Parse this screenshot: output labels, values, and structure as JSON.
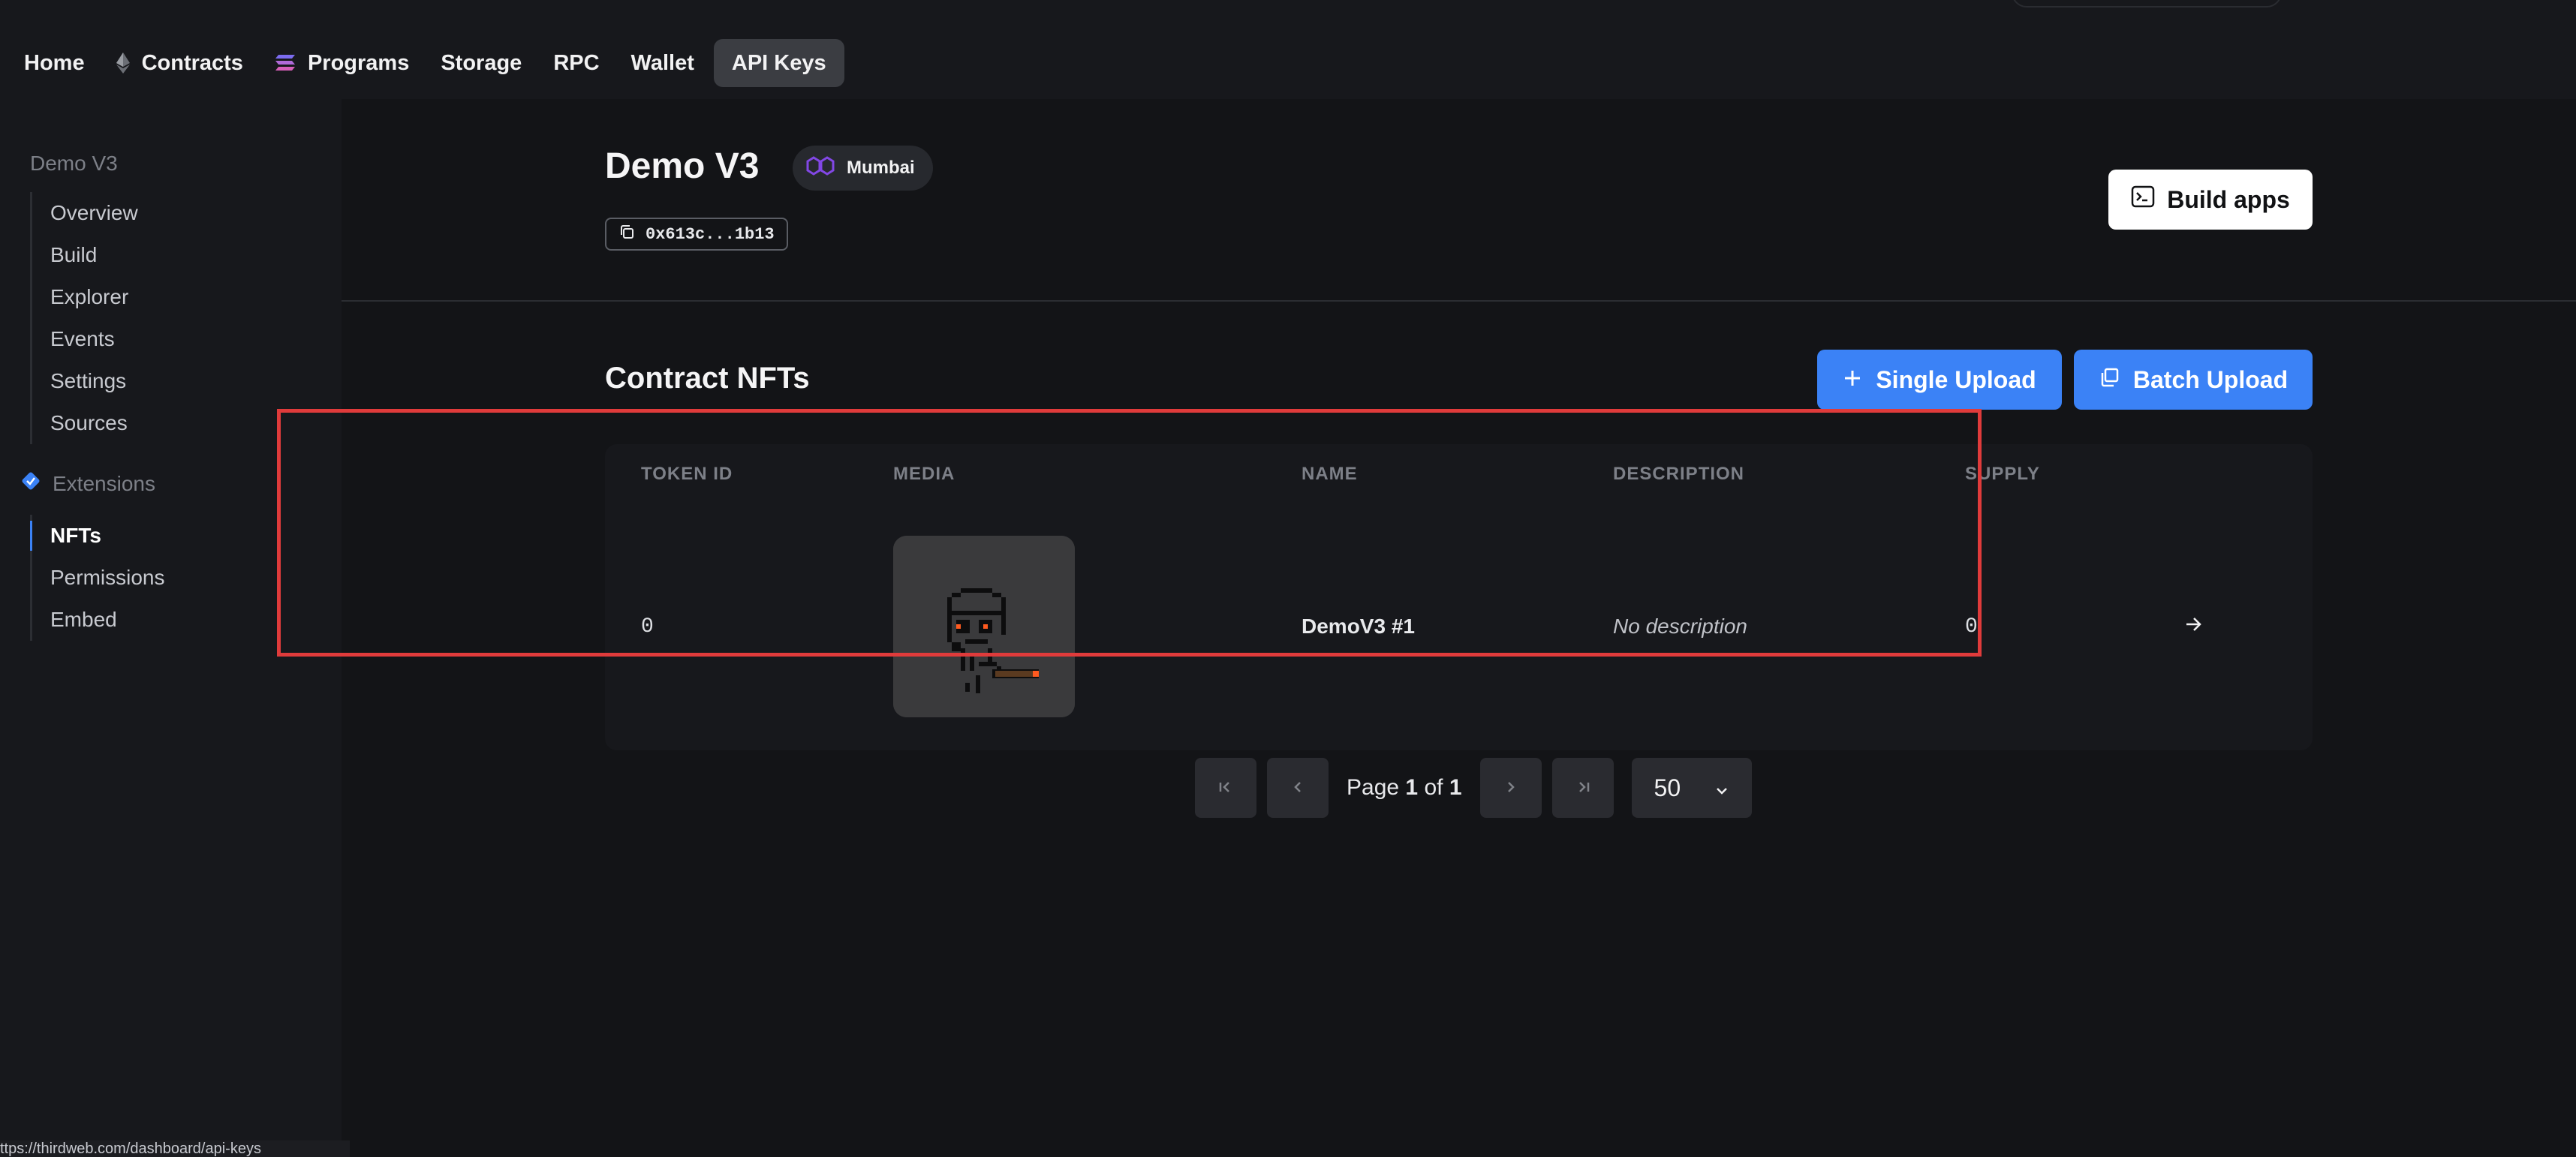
{
  "nav": {
    "items": [
      {
        "label": "Home",
        "icon": null
      },
      {
        "label": "Contracts",
        "icon": "ethereum-icon"
      },
      {
        "label": "Programs",
        "icon": "solana-icon"
      },
      {
        "label": "Storage",
        "icon": null
      },
      {
        "label": "RPC",
        "icon": null
      },
      {
        "label": "Wallet",
        "icon": null
      },
      {
        "label": "API Keys",
        "icon": null,
        "active": true
      }
    ]
  },
  "sidebar": {
    "group_title": "Demo V3",
    "items": [
      "Overview",
      "Build",
      "Explorer",
      "Events",
      "Settings",
      "Sources"
    ],
    "extensions_title": "Extensions",
    "extension_items": [
      "NFTs",
      "Permissions",
      "Embed"
    ],
    "active_item": "NFTs"
  },
  "header": {
    "title": "Demo V3",
    "network": "Mumbai",
    "address": "0x613c...1b13",
    "build_button": "Build apps"
  },
  "section": {
    "title": "Contract NFTs",
    "single_upload": "Single Upload",
    "batch_upload": "Batch Upload"
  },
  "table": {
    "columns": [
      "TOKEN ID",
      "MEDIA",
      "NAME",
      "DESCRIPTION",
      "SUPPLY"
    ],
    "rows": [
      {
        "token_id": "0",
        "name": "DemoV3 #1",
        "description": "No description",
        "supply": "0"
      }
    ]
  },
  "pagination": {
    "page_word": "Page",
    "current": "1",
    "of_word": "of",
    "total": "1",
    "page_size": "50"
  },
  "status_url": "ttps://thirdweb.com/dashboard/api-keys",
  "colors": {
    "accent": "#3b82f6",
    "highlight": "#e03b3b",
    "background": "#131417"
  }
}
